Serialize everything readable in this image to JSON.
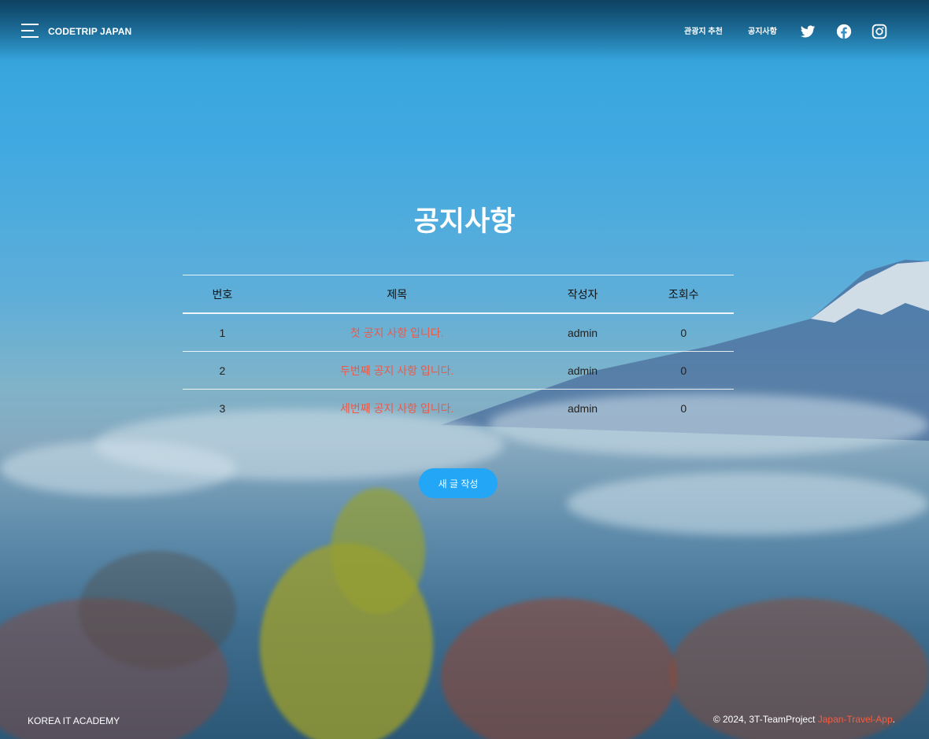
{
  "header": {
    "brand": "CODETRIP JAPAN",
    "nav": [
      "관광지 추천",
      "공지사항"
    ],
    "social_icons": [
      "twitter-icon",
      "facebook-icon",
      "instagram-icon"
    ]
  },
  "main": {
    "title": "공지사항",
    "columns": [
      "번호",
      "제목",
      "작성자",
      "조회수"
    ],
    "rows": [
      {
        "no": "1",
        "title": "첫 공지 사항 입니다.",
        "author": "admin",
        "views": "0"
      },
      {
        "no": "2",
        "title": "두번째 공지 사항 입니다.",
        "author": "admin",
        "views": "0"
      },
      {
        "no": "3",
        "title": "세번째 공지 사항 입니다.",
        "author": "admin",
        "views": "0"
      }
    ],
    "write_button": "새 글 작성"
  },
  "footer": {
    "left": "KOREA IT ACADEMY",
    "right_prefix": "© 2024, 3T-TeamProject ",
    "right_link": "Japan-Travel-App",
    "right_suffix": "."
  },
  "colors": {
    "accent_button": "#22a6f5",
    "link": "#ea5a4a",
    "footer_link": "#ff5a3c"
  }
}
